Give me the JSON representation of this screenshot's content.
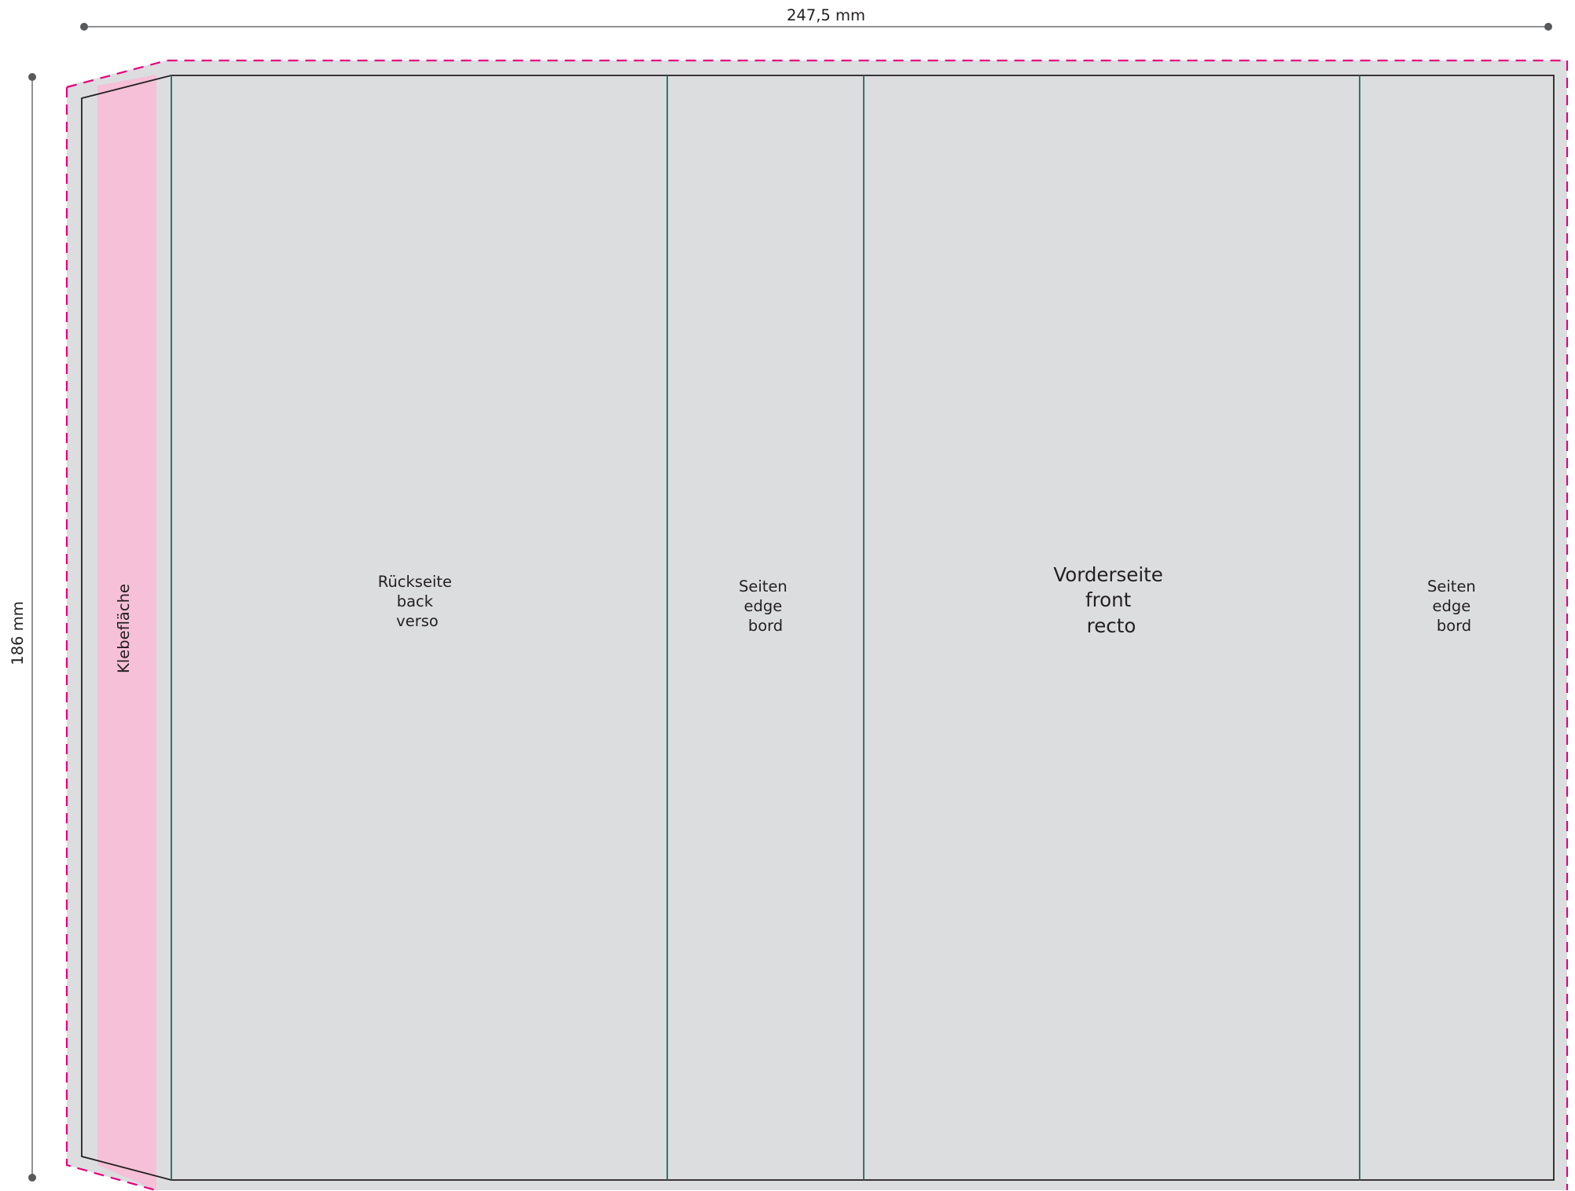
{
  "dimensions": {
    "width_label": "247,5 mm",
    "height_label": "186 mm"
  },
  "panels": {
    "glue_area": "Klebefläche",
    "back": [
      "Rückseite",
      "back",
      "verso"
    ],
    "edge_left": [
      "Seiten",
      "edge",
      "bord"
    ],
    "front": [
      "Vorderseite",
      "front",
      "recto"
    ],
    "edge_right": [
      "Seiten",
      "edge",
      "bord"
    ]
  },
  "colors": {
    "background_fill": "#dcdddf",
    "glue_fill": "#f5c0d8",
    "bleed_line": "#e6007e",
    "fold_line": "#1c6b60",
    "cut_line": "#231f20",
    "dimension_line": "#6d6e71"
  }
}
